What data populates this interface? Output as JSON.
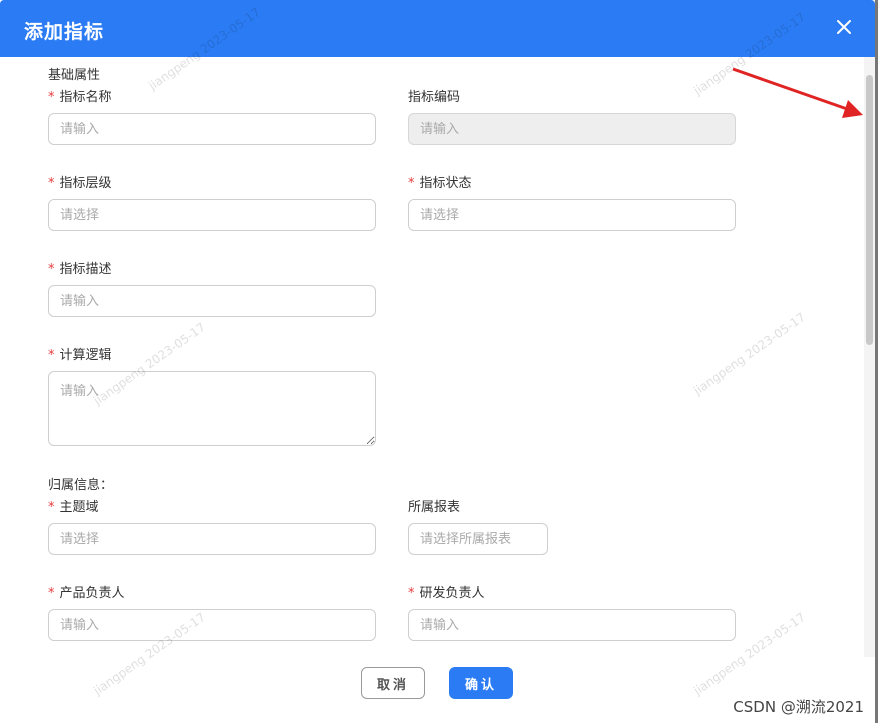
{
  "dialog": {
    "title": "添加指标",
    "close_icon": "close-icon"
  },
  "sections": {
    "basic": "基础属性",
    "owner": "归属信息："
  },
  "fields": {
    "name": {
      "label": "指标名称",
      "required": true,
      "placeholder": "请输入"
    },
    "code": {
      "label": "指标编码",
      "required": false,
      "placeholder": "请输入",
      "disabled": true
    },
    "level": {
      "label": "指标层级",
      "required": true,
      "placeholder": "请选择"
    },
    "status": {
      "label": "指标状态",
      "required": true,
      "placeholder": "请选择"
    },
    "desc": {
      "label": "指标描述",
      "required": true,
      "placeholder": "请输入"
    },
    "logic": {
      "label": "计算逻辑",
      "required": true,
      "placeholder": "请输入"
    },
    "domain": {
      "label": "主题域",
      "required": true,
      "placeholder": "请选择"
    },
    "report": {
      "label": "所属报表",
      "required": false,
      "placeholder": "请选择所属报表"
    },
    "product_owner": {
      "label": "产品负责人",
      "required": true,
      "placeholder": "请输入"
    },
    "dev_owner": {
      "label": "研发负责人",
      "required": true,
      "placeholder": "请输入"
    }
  },
  "footer": {
    "cancel_label": "取消",
    "ok_label": "确认"
  },
  "required_mark": "*",
  "watermark_text": "jiangpeng 2023-05-17",
  "csdn_credit": "CSDN @溯流2021",
  "colors": {
    "primary": "#2b7cf4",
    "required": "#e23b3b",
    "arrow": "#e02424"
  }
}
